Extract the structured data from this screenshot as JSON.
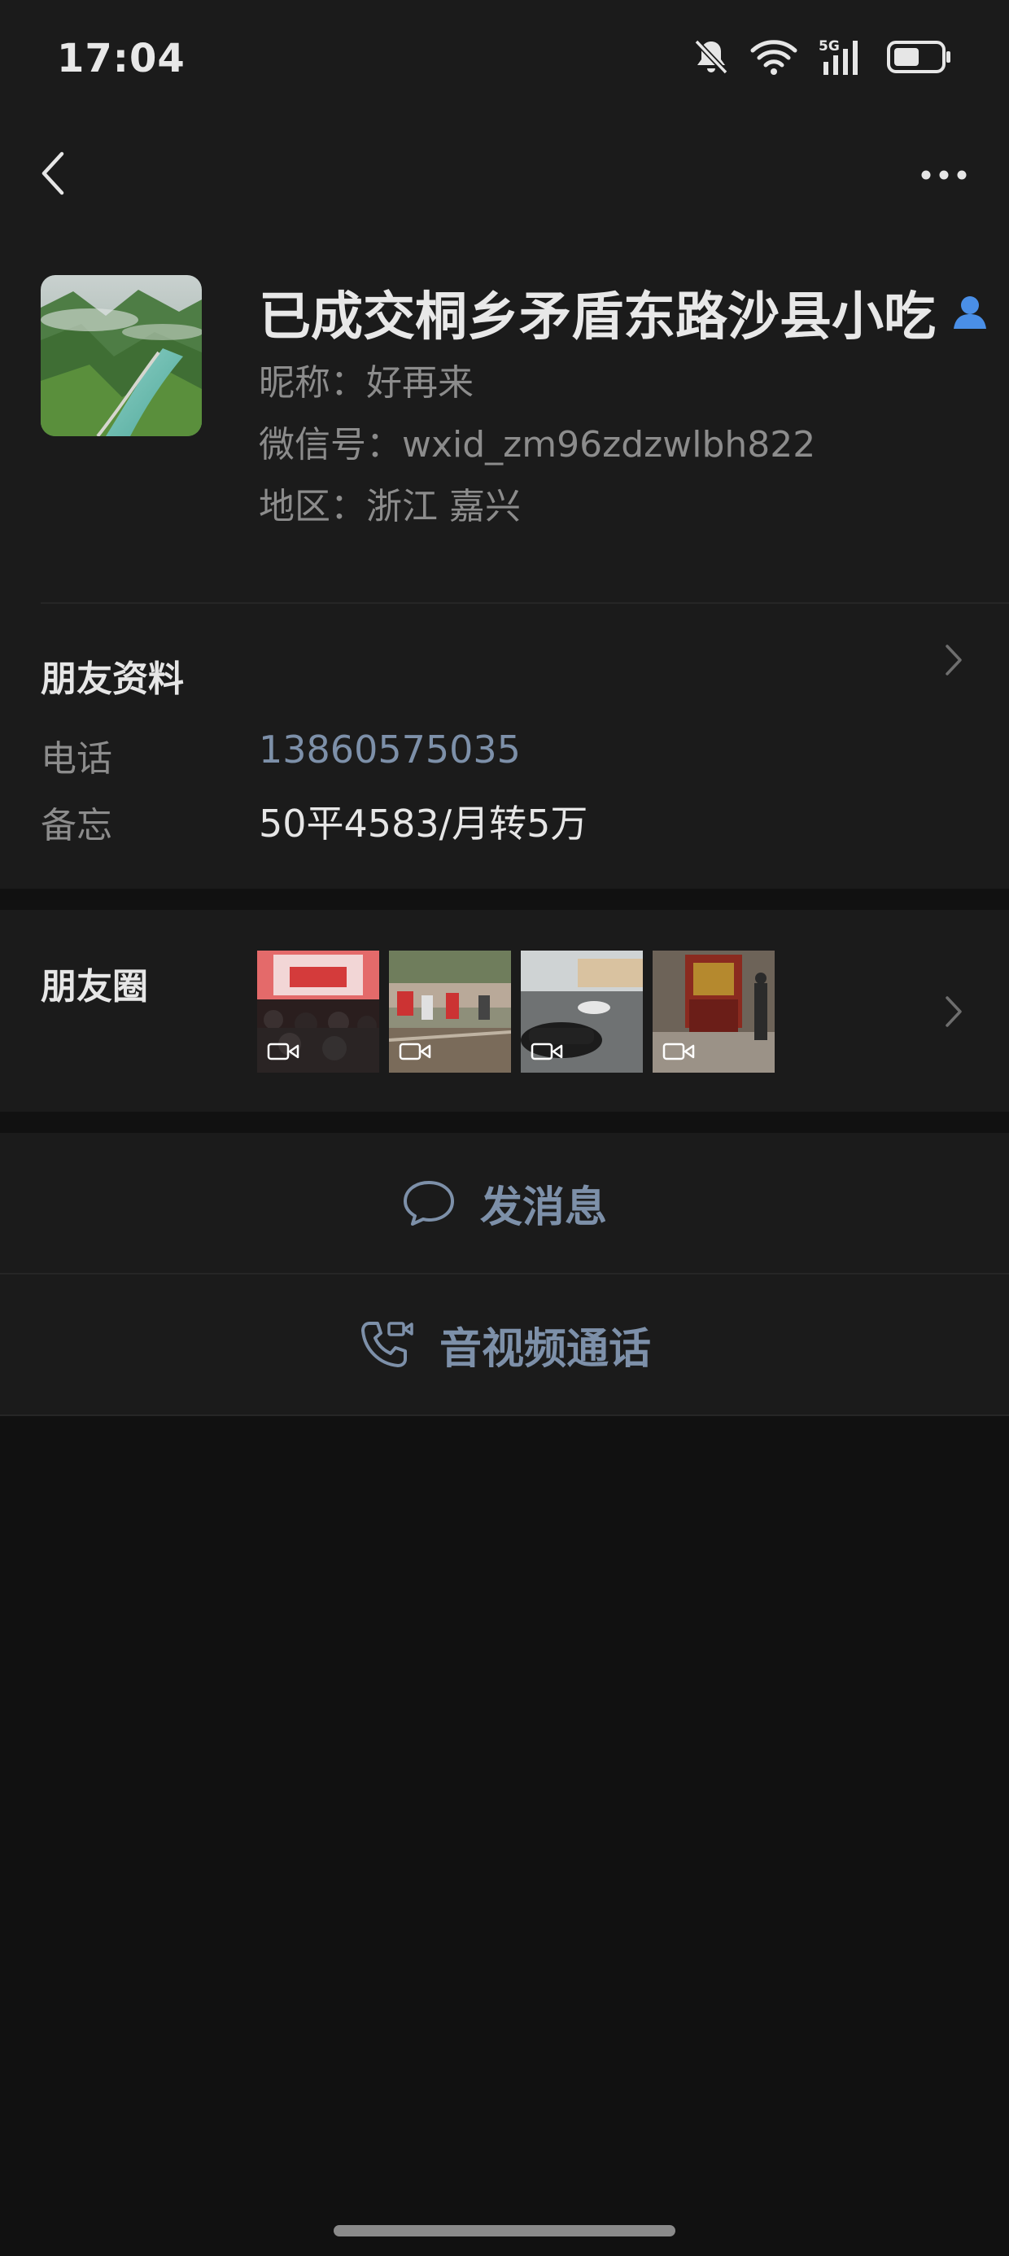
{
  "status_bar": {
    "time": "17:04",
    "network_label": "5G",
    "icons": [
      "bell-muted-icon",
      "wifi-icon",
      "signal-5g-icon",
      "battery-icon"
    ]
  },
  "nav": {
    "back_icon": "chevron-left-icon",
    "more_icon": "more-dots-icon"
  },
  "profile": {
    "name": "已成交桐乡矛盾东路沙县小吃",
    "nickname_line": "昵称：好再来",
    "wechat_id_line": "微信号：wxid_zm96zdzwlbh822",
    "region_line": "地区：浙江  嘉兴",
    "verified_icon": "contact-person-icon"
  },
  "friend_info": {
    "title": "朋友资料",
    "rows": [
      {
        "label": "电话",
        "value": "13860575035"
      },
      {
        "label": "备忘",
        "value": "50平4583/月转5万"
      }
    ]
  },
  "moments": {
    "title": "朋友圈",
    "thumbnail_count": 4
  },
  "actions": {
    "message_label": "发消息",
    "call_label": "音视频通话"
  },
  "colors": {
    "background": "#111111",
    "panel": "#1b1b1b",
    "accent_link": "#7d90a9",
    "verified_blue": "#4a8fe7"
  }
}
